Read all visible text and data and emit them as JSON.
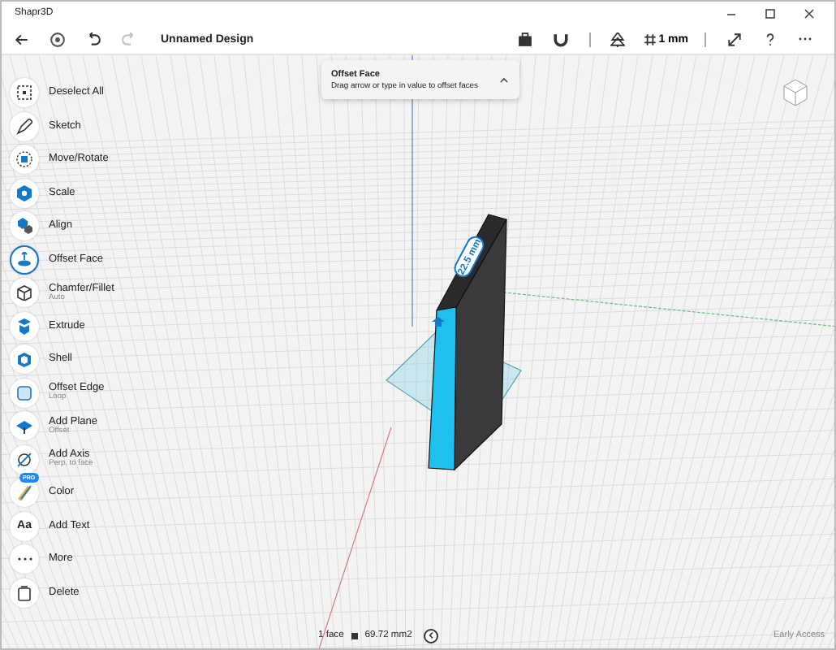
{
  "window": {
    "title": "Shapr3D"
  },
  "toolbar": {
    "document_title": "Unnamed Design",
    "left_buttons": [
      {
        "kind": "back",
        "disabled": false
      },
      {
        "kind": "settings",
        "disabled": false
      },
      {
        "kind": "undo",
        "disabled": false
      },
      {
        "kind": "redo",
        "disabled": true
      }
    ],
    "right_buttons": [
      {
        "kind": "clipboard"
      },
      {
        "kind": "magnet"
      },
      {
        "kind": "separator"
      },
      {
        "kind": "tree"
      },
      {
        "kind": "grid",
        "label": "1 mm"
      },
      {
        "kind": "separator"
      },
      {
        "kind": "expand"
      },
      {
        "kind": "help"
      },
      {
        "kind": "more"
      }
    ]
  },
  "sidebar": {
    "items": [
      {
        "kind": "deselect",
        "label": "Deselect All",
        "selected": false
      },
      {
        "kind": "sketch",
        "label": "Sketch",
        "selected": false
      },
      {
        "kind": "move",
        "label": "Move/Rotate",
        "selected": false
      },
      {
        "kind": "scale",
        "label": "Scale",
        "selected": false
      },
      {
        "kind": "align",
        "label": "Align",
        "selected": false
      },
      {
        "kind": "offset",
        "label": "Offset Face",
        "selected": true
      },
      {
        "kind": "chamfer",
        "label": "Chamfer/Fillet",
        "sublabel": "Auto",
        "selected": false
      },
      {
        "kind": "extrude",
        "label": "Extrude",
        "selected": false
      },
      {
        "kind": "shell",
        "label": "Shell",
        "selected": false
      },
      {
        "kind": "edge",
        "label": "Offset Edge",
        "sublabel": "Loop",
        "selected": false
      },
      {
        "kind": "plane",
        "label": "Add Plane",
        "sublabel": "Offset",
        "selected": false
      },
      {
        "kind": "axis",
        "label": "Add Axis",
        "sublabel": "Perp. to face",
        "selected": false
      },
      {
        "kind": "color",
        "label": "Color",
        "badge": "PRO",
        "selected": false
      },
      {
        "kind": "text",
        "label": "Add Text",
        "icon_text": "Aa",
        "selected": false
      },
      {
        "kind": "more",
        "label": "More",
        "selected": false
      },
      {
        "kind": "delete",
        "label": "Delete",
        "selected": false
      }
    ]
  },
  "popover": {
    "title": "Offset Face",
    "hint": "Drag arrow or type in value to offset faces"
  },
  "viewport": {
    "dimension": "22.5 mm"
  },
  "status_bar": {
    "selection": "1 face",
    "area": "69.72 mm2",
    "badge": "Early Access"
  }
}
